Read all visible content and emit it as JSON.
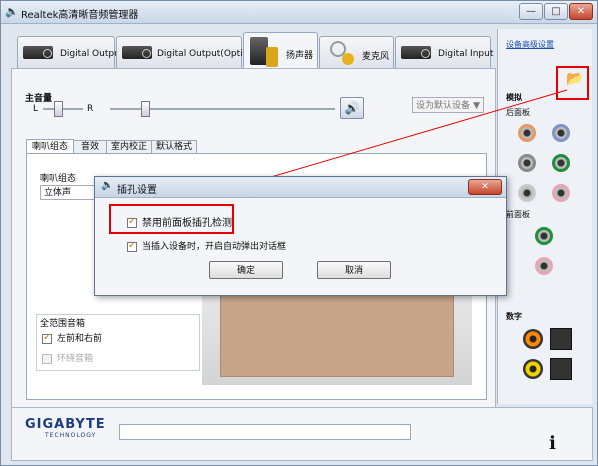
{
  "window": {
    "title": "Realtek高清晰音频管理器",
    "buttons": {
      "minimize": "—",
      "maximize": "□",
      "close": "✕"
    }
  },
  "tabs": [
    {
      "label": "Digital Output"
    },
    {
      "label": "Digital Output(Optical)"
    },
    {
      "label": "扬声器"
    },
    {
      "label": "麦克风"
    },
    {
      "label": "Digital Input"
    }
  ],
  "volume": {
    "title": "主音量",
    "left": "L",
    "right": "R",
    "balance": 0.35,
    "level": 0.15,
    "default_device_placeholder": "设为默认设备"
  },
  "subtabs": [
    {
      "label": "喇叭组态"
    },
    {
      "label": "音效"
    },
    {
      "label": "室内校正"
    },
    {
      "label": "默认格式"
    }
  ],
  "speaker_config": {
    "label": "喇叭组态",
    "value": "立体声"
  },
  "full_range": {
    "title": "全范围音箱",
    "front": "左前和右前",
    "surround": "环绕音箱"
  },
  "right_panel": {
    "advanced_link": "设备高级设置",
    "analog": "模拟",
    "rear_panel": "后面板",
    "front_panel": "前面板",
    "digital": "数字",
    "colors": {
      "orange": "#e39a67",
      "blue": "#7d95c6",
      "gray": "#8a8a8a",
      "green": "#1f8f3a",
      "pink": "#e6a7b4",
      "light_gray": "#c9c9c9"
    }
  },
  "dialog": {
    "title": "插孔设置",
    "option1": "禁用前面板插孔检测",
    "option2": "当插入设备时，开启自动弹出对话框",
    "ok": "确定",
    "cancel": "取消"
  },
  "footer": {
    "brand": "GIGABYTE",
    "tagline": "TECHNOLOGY"
  },
  "annotation_color": "#e60000"
}
